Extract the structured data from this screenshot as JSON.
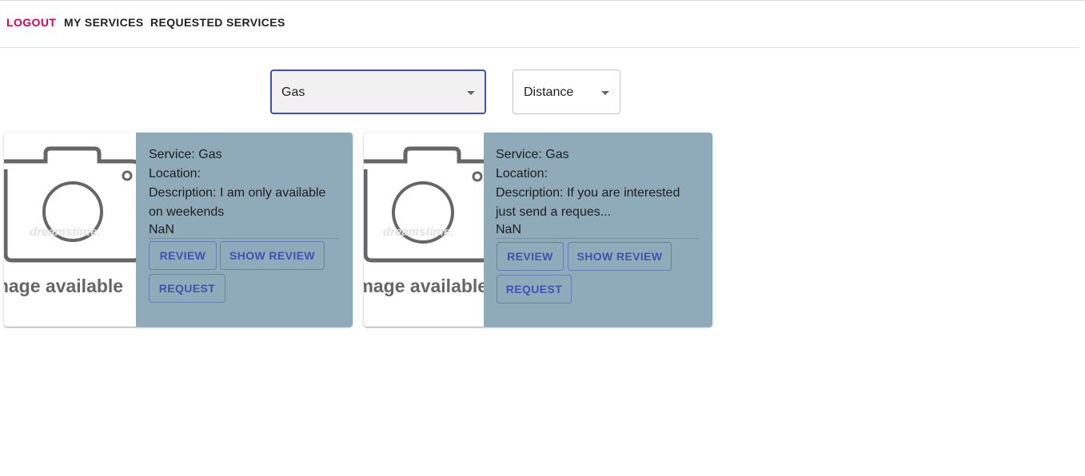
{
  "nav": {
    "logout": "LOGOUT",
    "my_services": "MY SERVICES",
    "requested_services": "REQUESTED SERVICES"
  },
  "filters": {
    "service_value": "Gas",
    "sort_value": "Distance"
  },
  "placeholder_image": {
    "no_image_text": "No image available",
    "watermark": "dreamstime."
  },
  "cards": [
    {
      "service_label": "Service:",
      "service_value": "Gas",
      "location_label": "Location:",
      "location_value": "",
      "description_label": "Description:",
      "description_line1": "I am only available",
      "description_line2": "on weekends",
      "rating": "NaN",
      "review_label": "REVIEW",
      "show_review_label": "SHOW REVIEW",
      "request_label": "REQUEST"
    },
    {
      "service_label": "Service:",
      "service_value": "Gas",
      "location_label": "Location:",
      "location_value": "",
      "description_label": "Description:",
      "description_line1": "If you are interested",
      "description_line2": "just send a reques...",
      "rating": "NaN",
      "review_label": "REVIEW",
      "show_review_label": "SHOW REVIEW",
      "request_label": "REQUEST"
    }
  ],
  "colors": {
    "accent": "#dc004e",
    "primary": "#3f51b5",
    "card_background": "#8fabba"
  },
  "icons": {
    "select_caret": "arrow-drop-down-icon",
    "placeholder": "camera-icon"
  }
}
